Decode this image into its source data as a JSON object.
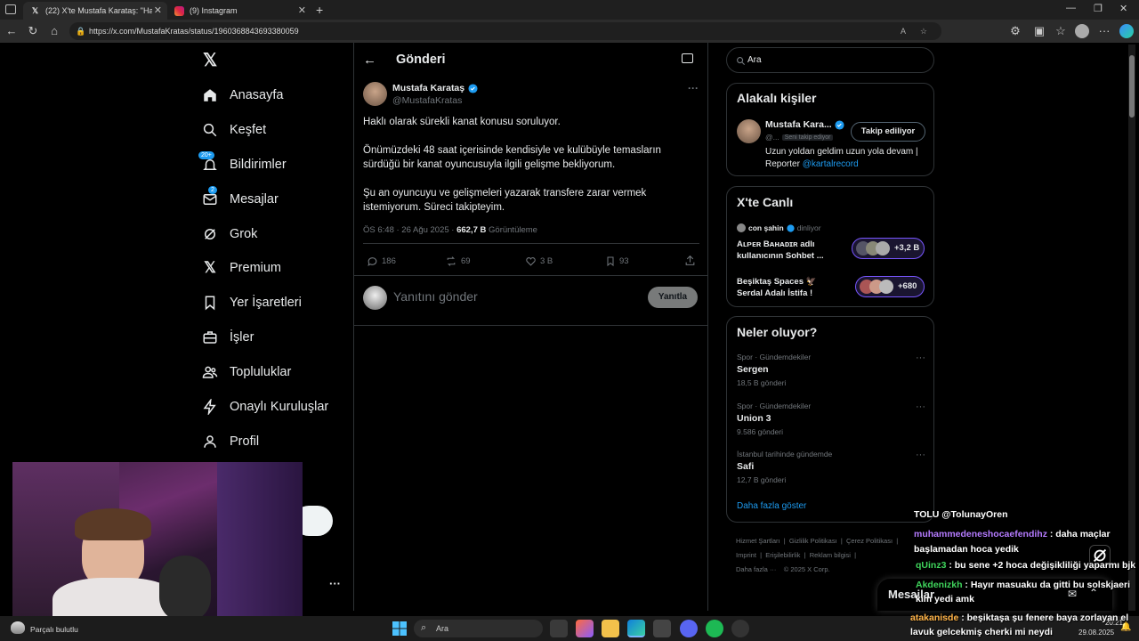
{
  "browser": {
    "tabs": [
      {
        "label": "(22) X'te Mustafa Karataş: \"Haklı o",
        "icon": "x-logo"
      },
      {
        "label": "(9) Instagram",
        "icon": "instagram"
      }
    ],
    "url": "https://x.com/MustafaKratas/status/1960368843693380059"
  },
  "nav": {
    "items": [
      {
        "label": "Anasayfa",
        "icon": "home-icon"
      },
      {
        "label": "Keşfet",
        "icon": "search-icon"
      },
      {
        "label": "Bildirimler",
        "icon": "bell-icon",
        "badge": "20+"
      },
      {
        "label": "Mesajlar",
        "icon": "mail-icon",
        "badge": "2"
      },
      {
        "label": "Grok",
        "icon": "grok-icon"
      },
      {
        "label": "Premium",
        "icon": "x-icon"
      },
      {
        "label": "Yer İşaretleri",
        "icon": "bookmark-icon"
      },
      {
        "label": "İşler",
        "icon": "briefcase-icon"
      },
      {
        "label": "Topluluklar",
        "icon": "people-icon"
      },
      {
        "label": "Onaylı Kuruluşlar",
        "icon": "lightning-icon"
      },
      {
        "label": "Profil",
        "icon": "person-icon"
      }
    ],
    "more": "···"
  },
  "post": {
    "header": "Gönderi",
    "author_name": "Mustafa Karataş",
    "handle": "@MustafaKratas",
    "paragraphs": [
      "Haklı olarak sürekli kanat konusu soruluyor.",
      "Önümüzdeki 48 saat içerisinde kendisiyle ve kulübüyle temasların sürdüğü bir kanat oyuncusuyla ilgili gelişme bekliyorum.",
      "Şu an oyuncuyu ve gelişmeleri yazarak transfere zarar vermek istemiyorum. Süreci takipteyim."
    ],
    "time": "ÖS 6:48 · 26 Ağu 2025 · ",
    "views": "662,7 B",
    "views_label": "Görüntüleme",
    "stats": {
      "replies": "186",
      "reposts": "69",
      "likes": "3 B",
      "bookmarks": "93"
    },
    "reply_placeholder": "Yanıtını gönder",
    "reply_button": "Yanıtla"
  },
  "search": {
    "placeholder": "Ara"
  },
  "related": {
    "title": "Alakalı kişiler",
    "name": "Mustafa Kara...",
    "handle": "@...",
    "follows_you": "Seni takip ediyor",
    "follow_button": "Takip ediliyor",
    "bio": "Uzun yoldan geldim uzun yola devam | Reporter ",
    "bio_link": "@kartalrecord"
  },
  "live": {
    "title": "X'te Canlı",
    "host": "con şahin",
    "host_status": "dinliyor",
    "items": [
      {
        "title": "Aʟᴘᴇʀ Bᴀʜᴀᴅɪʀ adlı kullanıcının Sohbet ...",
        "count": "+3,2 B"
      },
      {
        "title": "Beşiktaş Spaces 🦅 Serdal Adalı İstifa !",
        "count": "+680"
      }
    ]
  },
  "trends": {
    "title": "Neler oluyor?",
    "items": [
      {
        "meta": "Spor · Gündemdekiler",
        "name": "Sergen",
        "count": "18,5 B gönderi"
      },
      {
        "meta": "Spor · Gündemdekiler",
        "name": "Union 3",
        "count": "9.586 gönderi"
      },
      {
        "meta": "İstanbul tarihinde gündemde",
        "name": "Safi",
        "count": "12,7 B gönderi"
      }
    ],
    "show_more": "Daha fazla göster"
  },
  "footer": {
    "links": [
      "Hizmet Şartları",
      "Gizlilik Politikası",
      "Çerez Politikası",
      "Imprint",
      "Erişilebilirlik",
      "Reklam bilgisi",
      "Daha fazla ···",
      "© 2025 X Corp."
    ]
  },
  "messages_dock": "Mesajlar",
  "chat": [
    {
      "user": "TOLU @TolunayOren",
      "text": "",
      "color": "#ffffff"
    },
    {
      "user": "muhammedeneshocaefendihz",
      "text": " : daha maçlar başlamadan hoca yedik",
      "color": "#b57bff"
    },
    {
      "user": "qUinz3",
      "text": " : bu sene +2 hoca değişikliliği yaparmı bjk",
      "color": "#3fd45c"
    },
    {
      "user": "Akdenizkh",
      "text": " : Hayır masuaku da gitti bu solskjaeri kim yedi amk",
      "color": "#3fd45c"
    },
    {
      "user": "atakanisde",
      "text": " : beşiktaşa şu fenere baya zorlayan el lavuk gelcekmiş cherki mi neydi",
      "color": "#ffb347"
    }
  ],
  "taskbar": {
    "weather": "Parçalı bulutlu",
    "search": "Ara",
    "time": "20:21",
    "date": "29.08.2025"
  }
}
